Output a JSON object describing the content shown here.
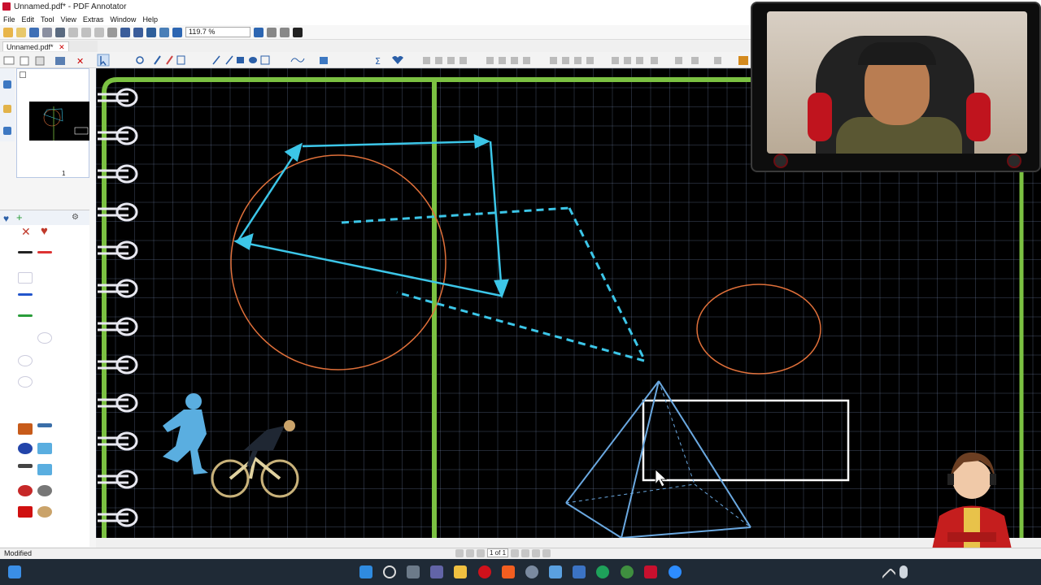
{
  "window": {
    "title": "Unnamed.pdf* - PDF Annotator"
  },
  "menu": [
    "File",
    "Edit",
    "Tool",
    "View",
    "Extras",
    "Window",
    "Help"
  ],
  "toolbar": {
    "zoom_value": "119.7 %"
  },
  "document_tab": {
    "label": "Unnamed.pdf*",
    "close": "✕"
  },
  "sidebar": {
    "page_number": "1"
  },
  "status": {
    "text": "Modified",
    "page_indicator": "1 of 1"
  },
  "colors": {
    "canvas_bg": "#000000",
    "margin_green": "#7bc142",
    "cyan_stroke": "#3cc6e8",
    "orange_stroke": "#e0703a",
    "pyramid_stroke": "#6aa8e0",
    "runner_blue": "#5aaee0"
  },
  "icons": {
    "app": "pdf-annotator-icon",
    "rings": "binder-ring-icon",
    "cursor": "mouse-pointer-icon"
  }
}
